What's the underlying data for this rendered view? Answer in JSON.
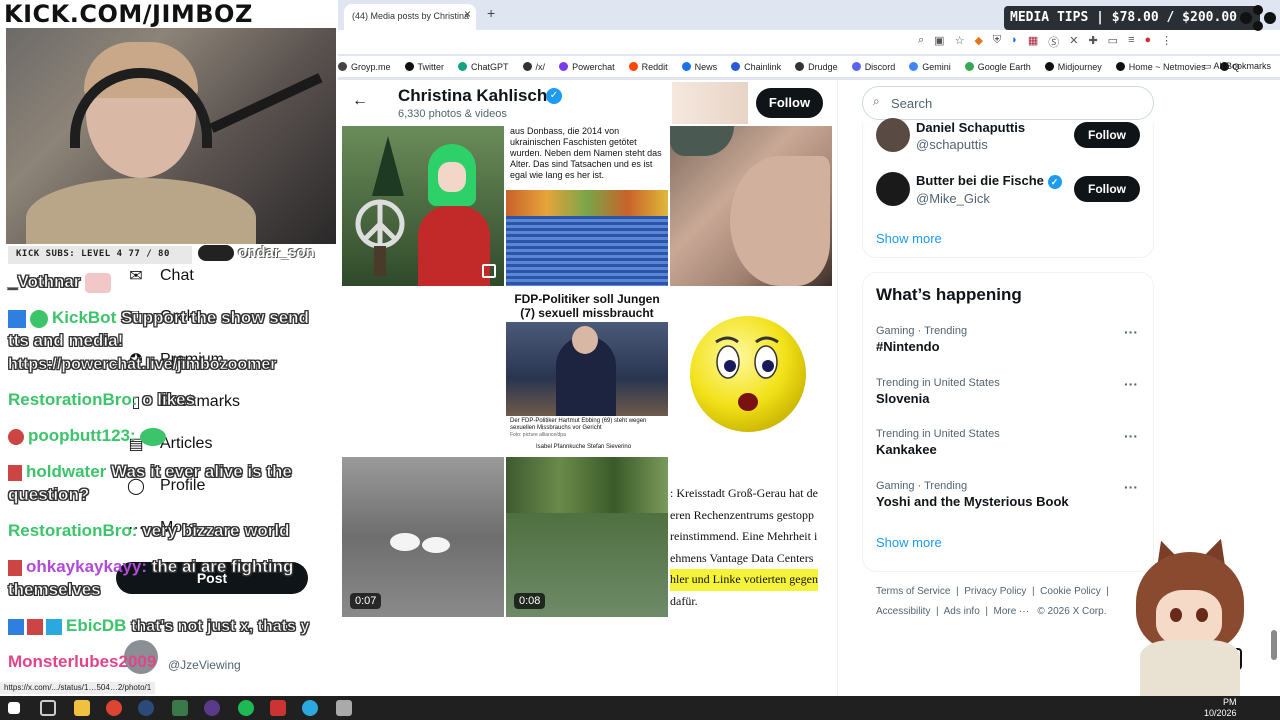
{
  "overlay": {
    "channel_title": "KICK.COM/JIMBOZ",
    "media_tips": "MEDIA TIPS | $78.00 / $200.00",
    "subs_bar": "KICK SUBS: LEVEL 4 77 / 80"
  },
  "browser": {
    "tab_title": "(44) Media posts by Christina",
    "tab_close": "×",
    "tab_new": "+",
    "bookmarks": [
      "Groyp.me",
      "Twitter",
      "ChatGPT",
      "/x/",
      "Powerchat",
      "Reddit",
      "News",
      "Chainlink",
      "Drudge",
      "Discord",
      "Gemini",
      "Google Earth",
      "Midjourney",
      "Home ~ Netmovies",
      "Q"
    ],
    "bookmark_colors": [
      "#444",
      "#111",
      "#10a37f",
      "#333",
      "#7c3aed",
      "#ff4500",
      "#1a73e8",
      "#2a5ada",
      "#333",
      "#5865f2",
      "#4285f4",
      "#34a853",
      "#111",
      "#111",
      "#111"
    ],
    "all_bookmarks": "All Bookmarks"
  },
  "chat": {
    "lines": [
      {
        "user": "",
        "msg": "_Vothnar"
      },
      {
        "user": "KickBot",
        "msg": "Support the show send"
      },
      {
        "user": "",
        "msg": "tts and media!"
      },
      {
        "user": "",
        "msg": "https://powerchat.live/jimbozoomer"
      },
      {
        "user": "RestorationBro:",
        "msg": "o likes"
      },
      {
        "user": "poopbutt123:",
        "msg": ""
      },
      {
        "user": "holdwater",
        "msg": "Was it ever alive is the"
      },
      {
        "user": "",
        "msg": "question?"
      },
      {
        "user": "RestorationBro:",
        "msg": "very bizzare world"
      },
      {
        "user": "ohkaykaykayy:",
        "msg": "the ai are fighting"
      },
      {
        "user": "",
        "msg": "themselves"
      },
      {
        "user": "EbicDB",
        "msg": "that's not just x, thats y"
      },
      {
        "user": "Monsterlubes2009",
        "msg": ""
      }
    ],
    "overlap_user": "ondar_son"
  },
  "x_nav": {
    "items": [
      "Chat",
      "Grok",
      "Premium",
      "Bookmarks",
      "Articles",
      "Profile",
      "More"
    ],
    "post_label": "Post",
    "account_handle": "@JzeViewing",
    "status_url": "https://x.com/.../status/1…504…2/photo/1"
  },
  "profile": {
    "name": "Christina Kahlisch",
    "count": "6,330 photos & videos",
    "follow_label": "Follow",
    "back_label": "←"
  },
  "media": {
    "tile2_text": "aus Donbass, die 2014 von ukrainischen Faschisten getötet wurden. Neben dem Namen steht das Alter. Das sind Tatsachen und es ist egal wie lang es her ist.",
    "tile5_headline": "FDP-Politiker soll Jungen (7) sexuell missbraucht haben",
    "tile5_caption": "Der FDP-Politiker Hartmut Ebbing (69) steht wegen sexuellen Missbrauchs vor Gericht",
    "tile5_credit": "Foto: picture alliance/dpa",
    "tile5_names": [
      "Isabel Pfannkuche",
      "Stefan Sieverino"
    ],
    "video1_duration": "0:07",
    "video2_duration": "0:08",
    "tile9_lines": [
      ": Kreisstadt Groß-Gerau hat de",
      "eren Rechenzentrums gestopp",
      "reinstimmend. Eine Mehrheit i",
      "ehmens Vantage Data Centers",
      "hler und Linke votierten gegen",
      "dafür."
    ]
  },
  "sidebar": {
    "search_placeholder": "Search",
    "who_to_follow": [
      {
        "name": "Daniel Schaputtis",
        "handle": "@schaputtis",
        "follow": "Follow"
      },
      {
        "name": "Butter bei die Fische",
        "handle": "@Mike_Gick",
        "follow": "Follow"
      }
    ],
    "show_more_1": "Show more",
    "whats_happening_title": "What’s happening",
    "trends": [
      {
        "meta": "Gaming · Trending",
        "name": "#Nintendo"
      },
      {
        "meta": "Trending in United States",
        "name": "Slovenia"
      },
      {
        "meta": "Trending in United States",
        "name": "Kankakee"
      },
      {
        "meta": "Gaming · Trending",
        "name": "Yoshi and the Mysterious Book"
      }
    ],
    "show_more_2": "Show more",
    "footer": [
      "Terms of Service",
      "Privacy Policy",
      "Cookie Policy",
      "Accessibility",
      "Ads info",
      "More ···",
      "© 2026 X Corp."
    ]
  },
  "taskbar": {
    "time": "PM",
    "date": "10/2026"
  }
}
